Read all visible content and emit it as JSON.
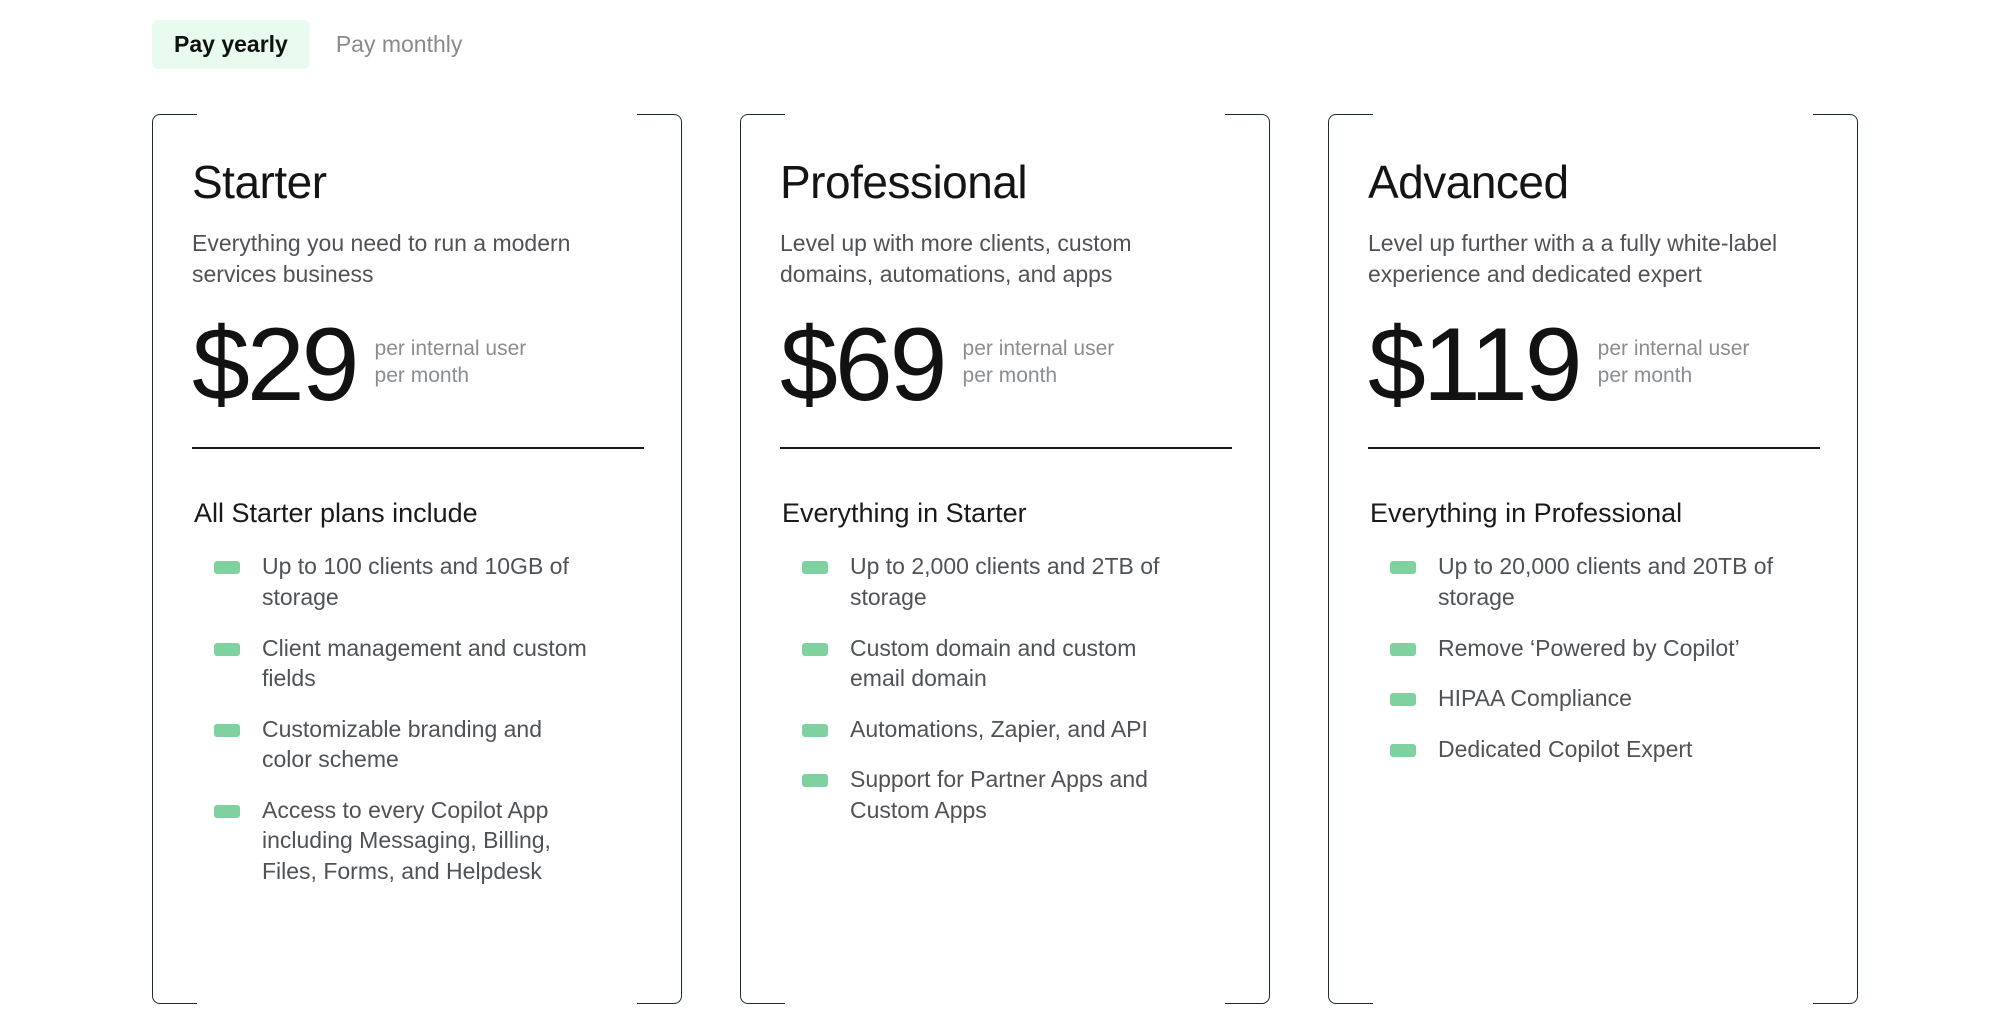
{
  "billing": {
    "options": [
      {
        "label": "Pay yearly",
        "active": true
      },
      {
        "label": "Pay monthly",
        "active": false
      }
    ]
  },
  "colors": {
    "tab_active_bg": "#e9faef",
    "bullet_green": "#7fd2a0",
    "card_border": "#1f2d27",
    "muted_text": "#4f5256",
    "price_unit_text": "#8a8d91"
  },
  "plans": [
    {
      "name": "Starter",
      "description": "Everything you need to run a modern services business",
      "price": "$29",
      "price_unit": "per internal user\nper month",
      "includes_title": "All Starter plans include",
      "features": [
        "Up to 100 clients and 10GB of storage",
        "Client management and custom fields",
        "Customizable branding and color scheme",
        "Access to every Copilot App including Messaging, Billing, Files, Forms, and Helpdesk"
      ]
    },
    {
      "name": "Professional",
      "description": "Level up with more clients, custom domains, automations, and apps",
      "price": "$69",
      "price_unit": "per internal user\nper month",
      "includes_title": "Everything in Starter",
      "features": [
        "Up to 2,000 clients and 2TB of storage",
        "Custom domain and custom email domain",
        "Automations, Zapier, and API",
        "Support for Partner Apps and Custom Apps"
      ]
    },
    {
      "name": "Advanced",
      "description": "Level up further with a a fully white-label experience and dedicated expert",
      "price": "$119",
      "price_unit": "per internal user\nper month",
      "includes_title": "Everything in Professional",
      "features": [
        "Up to 20,000 clients and 20TB of storage",
        "Remove ‘Powered by Copilot’",
        "HIPAA Compliance",
        "Dedicated Copilot Expert"
      ]
    }
  ]
}
